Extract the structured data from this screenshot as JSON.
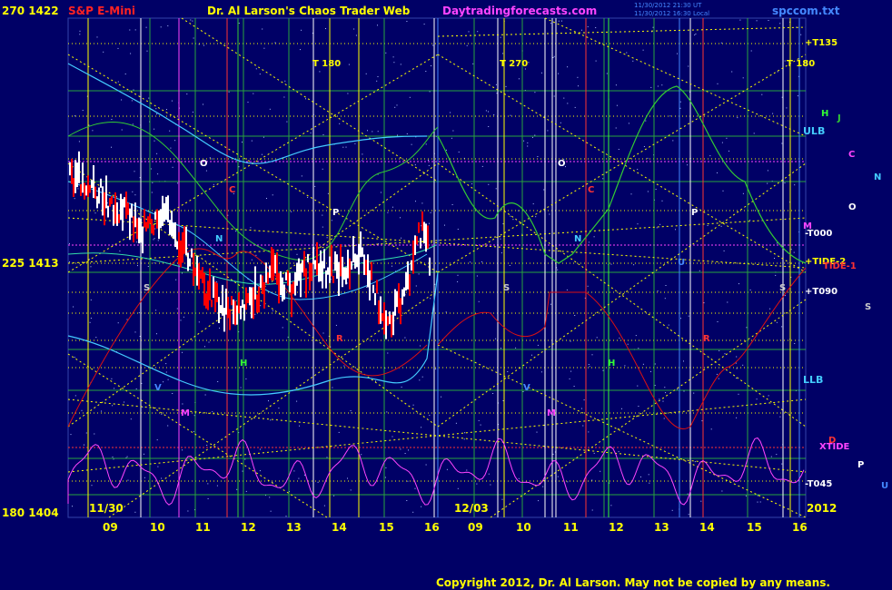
{
  "header": {
    "y_top": "270 1422",
    "symbol": "S&P E-Mini",
    "author_title": "Dr. Al Larson's Chaos Trader Web",
    "site": "Daytradingforecasts.com",
    "stamp1": "11/30/2012 21:30 UT",
    "stamp2": "11/30/2012 16:30 Local",
    "file": "spccom.txt"
  },
  "y_axis": {
    "top": "270 1422",
    "mid": "225 1413",
    "bottom": "180 1404"
  },
  "x_axis": {
    "date_left": "11/30",
    "date_mid": "12/03",
    "year": "2012",
    "ticks": [
      "09",
      "10",
      "11",
      "12",
      "13",
      "14",
      "15",
      "16",
      "09",
      "10",
      "11",
      "12",
      "13",
      "14",
      "15",
      "16"
    ]
  },
  "markers": {
    "t180_left": "T 180",
    "t270": "T 270",
    "t180_right": "T 180",
    "right_t135": "+T135",
    "right_t000": "-T000",
    "right_tide2": "+TIDE-2",
    "right_tide1": "TIDE-1",
    "right_t090": "+T090",
    "right_t045": "-T045",
    "xtide": "XTIDE",
    "ulb": "ULB",
    "llb": "LLB",
    "letters": {
      "O": "O",
      "C": "C",
      "N": "N",
      "P": "P",
      "S": "S",
      "R": "R",
      "H": "H",
      "J": "J",
      "M": "M",
      "U": "U",
      "V": "V",
      "D": "D",
      "T": "T"
    }
  },
  "colors": {
    "background": "#000066",
    "price_up": "#ffffff",
    "price_down": "#ff0000",
    "grid_yellow": "#ffff00",
    "grid_green": "#33cc33",
    "band_cyan": "#44ccff",
    "red_line": "#dd1111",
    "magenta_osc": "#ff44ff"
  },
  "footer": {
    "copyright": "Copyright 2012, Dr. Al Larson. May not be copied by any means."
  }
}
